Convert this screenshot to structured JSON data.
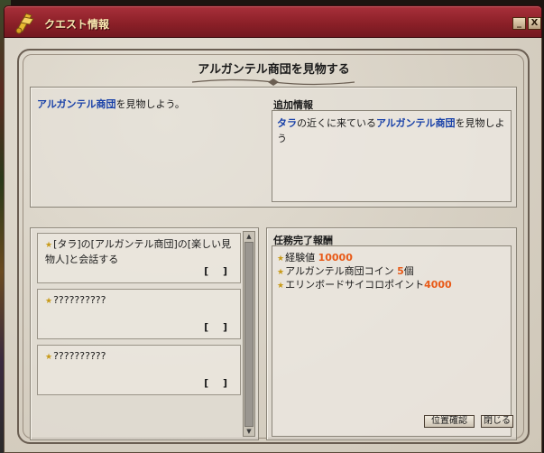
{
  "window": {
    "title": "クエスト情報",
    "min_label": "_",
    "close_label": "X"
  },
  "quest": {
    "title": "アルガンテル商団を見物する",
    "description": {
      "highlight": "アルガンテル商団",
      "rest": "を見物しよう。"
    },
    "extra_label": "追加情報",
    "extra": {
      "part1": "タラ",
      "part2": "の近くに来ている",
      "part3": "アルガンテル商団",
      "part4": "を見物しよう"
    }
  },
  "objectives": [
    {
      "text": "[タラ]の[アルガンテル商団]の[楽しい見物人]と会話する",
      "status": "[ ]"
    },
    {
      "text": "??????????",
      "status": "[ ]"
    },
    {
      "text": "??????????",
      "status": "[ ]"
    }
  ],
  "rewards": {
    "label": "任務完了報酬",
    "items": [
      {
        "name": "経験値",
        "value": "10000"
      },
      {
        "name": "アルガンテル商団コイン",
        "value": "5",
        "unit": "個"
      },
      {
        "name": "エリンボードサイコロポイント",
        "value": "4000"
      }
    ]
  },
  "buttons": {
    "location": "位置確認",
    "close": "閉じる"
  },
  "colors": {
    "title_bar": "#8c2028",
    "highlight_blue": "#1840a8",
    "value_orange": "#e85a18"
  }
}
